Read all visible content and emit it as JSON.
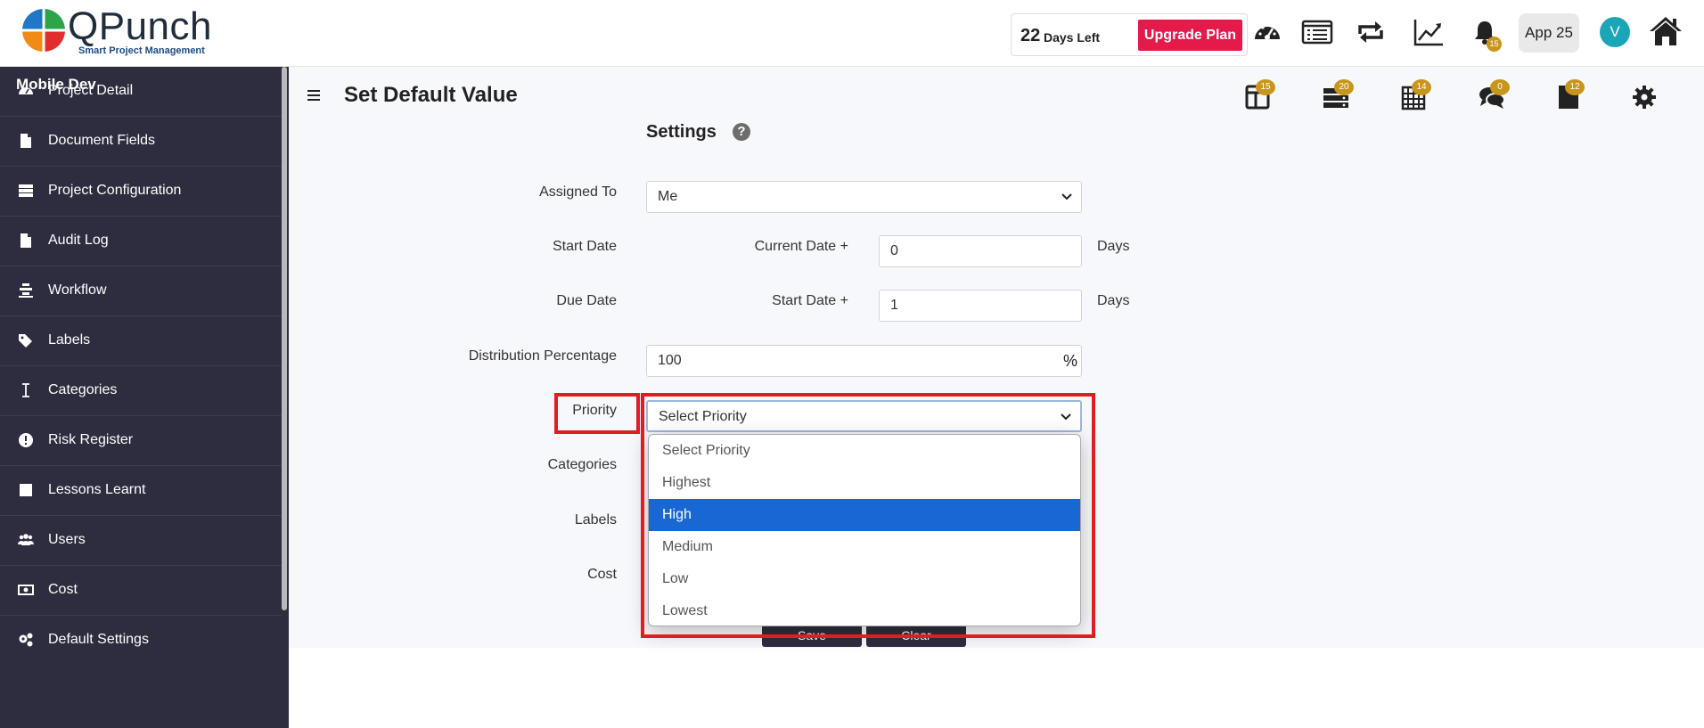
{
  "header": {
    "logo_name": "QPunch",
    "logo_tagline": "Smart Project Management",
    "days_left_number": "22",
    "days_left_text": "Days Left",
    "upgrade_label": "Upgrade Plan",
    "notification_count": "15",
    "app_label": "App 25",
    "avatar_initial": "V",
    "icons": [
      "dashboard-icon",
      "list-icon",
      "sync-icon",
      "chart-icon",
      "bell-icon",
      "home-icon"
    ]
  },
  "sidebar": {
    "project_title": "Mobile Dev",
    "items": [
      {
        "label": "Project Detail",
        "icon": "dashboard-icon"
      },
      {
        "label": "Document Fields",
        "icon": "document-icon"
      },
      {
        "label": "Project Configuration",
        "icon": "config-icon"
      },
      {
        "label": "Audit Log",
        "icon": "document-icon"
      },
      {
        "label": "Workflow",
        "icon": "workflow-icon"
      },
      {
        "label": "Labels",
        "icon": "tags-icon"
      },
      {
        "label": "Categories",
        "icon": "cursor-icon"
      },
      {
        "label": "Risk Register",
        "icon": "exclamation-icon"
      },
      {
        "label": "Lessons Learnt",
        "icon": "square-icon"
      },
      {
        "label": "Users",
        "icon": "users-icon"
      },
      {
        "label": "Cost",
        "icon": "money-icon"
      },
      {
        "label": "Default Settings",
        "icon": "cogs-icon"
      }
    ]
  },
  "main": {
    "page_title": "Set Default Value",
    "toolbar": [
      {
        "icon": "columns-icon",
        "badge": "15"
      },
      {
        "icon": "server-icon",
        "badge": "20"
      },
      {
        "icon": "calendar-icon",
        "badge": "14"
      },
      {
        "icon": "comments-icon",
        "badge": "0"
      },
      {
        "icon": "file-icon",
        "badge": "12"
      },
      {
        "icon": "gear-icon",
        "badge": ""
      }
    ],
    "settings_heading": "Settings",
    "help_glyph": "?",
    "form": {
      "assigned_to_label": "Assigned To",
      "assigned_to_value": "Me",
      "start_date_label": "Start Date",
      "start_date_prefix": "Current Date +",
      "start_date_value": "0",
      "start_date_unit": "Days",
      "due_date_label": "Due Date",
      "due_date_prefix": "Start Date +",
      "due_date_value": "1",
      "due_date_unit": "Days",
      "distribution_label": "Distribution Percentage",
      "distribution_value": "100",
      "distribution_unit": "%",
      "priority_label": "Priority",
      "priority_value": "Select Priority",
      "categories_label": "Categories",
      "labels_label": "Labels",
      "cost_label": "Cost",
      "save_label": "Save",
      "clear_label": "Clear"
    },
    "priority_options": [
      {
        "label": "Select Priority",
        "selected": false
      },
      {
        "label": "Highest",
        "selected": false
      },
      {
        "label": "High",
        "selected": true
      },
      {
        "label": "Medium",
        "selected": false
      },
      {
        "label": "Low",
        "selected": false
      },
      {
        "label": "Lowest",
        "selected": false
      }
    ]
  },
  "colors": {
    "sidebar_bg": "#2d2d3f",
    "upgrade_red": "#e6194b",
    "badge_gold": "#c8961d",
    "selected_blue": "#1967d2",
    "highlight_red": "#e31b23",
    "avatar_teal": "#1aa6b7"
  }
}
